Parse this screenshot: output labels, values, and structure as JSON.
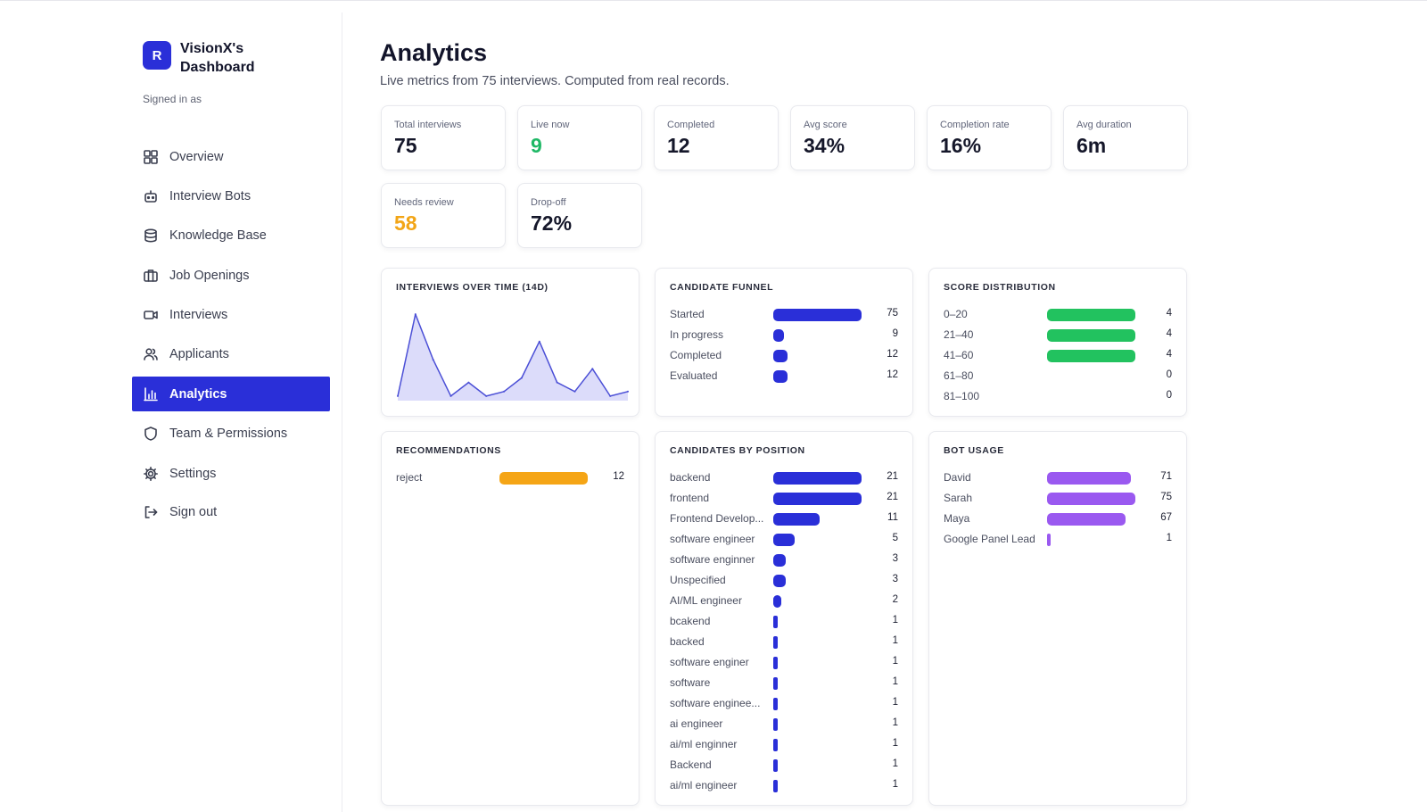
{
  "app": {
    "brand_initial": "R",
    "brand_name": "VisionX's Dashboard",
    "signed_in_label": "Signed in as"
  },
  "nav": [
    {
      "label": "Overview",
      "icon": "grid-icon"
    },
    {
      "label": "Interview Bots",
      "icon": "bot-icon"
    },
    {
      "label": "Knowledge Base",
      "icon": "database-icon"
    },
    {
      "label": "Job Openings",
      "icon": "briefcase-icon"
    },
    {
      "label": "Interviews",
      "icon": "video-icon"
    },
    {
      "label": "Applicants",
      "icon": "users-icon"
    },
    {
      "label": "Analytics",
      "icon": "chart-icon",
      "active": true
    },
    {
      "label": "Team & Permissions",
      "icon": "shield-icon"
    },
    {
      "label": "Settings",
      "icon": "gear-icon"
    },
    {
      "label": "Sign out",
      "icon": "logout-icon"
    }
  ],
  "page": {
    "title": "Analytics",
    "subtitle": "Live metrics from 75 interviews. Computed from real records."
  },
  "stats": [
    {
      "label": "Total interviews",
      "value": "75"
    },
    {
      "label": "Live now",
      "value": "9",
      "color": "#1fb866"
    },
    {
      "label": "Completed",
      "value": "12"
    },
    {
      "label": "Avg score",
      "value": "34%"
    },
    {
      "label": "Completion rate",
      "value": "16%"
    },
    {
      "label": "Avg duration",
      "value": "6m"
    },
    {
      "label": "Needs review",
      "value": "58",
      "color": "#f2a516"
    },
    {
      "label": "Drop-off",
      "value": "72%"
    }
  ],
  "cards": {
    "over_time": {
      "title": "INTERVIEWS OVER TIME (14D)"
    },
    "funnel": {
      "title": "CANDIDATE FUNNEL",
      "color": "#2a2fd8",
      "max": 75,
      "rows": [
        {
          "label": "Started",
          "value": 75
        },
        {
          "label": "In progress",
          "value": 9
        },
        {
          "label": "Completed",
          "value": 12
        },
        {
          "label": "Evaluated",
          "value": 12
        }
      ]
    },
    "score": {
      "title": "SCORE DISTRIBUTION",
      "color": "#22c25f",
      "max": 4,
      "rows": [
        {
          "label": "0–20",
          "value": 4
        },
        {
          "label": "21–40",
          "value": 4
        },
        {
          "label": "41–60",
          "value": 4
        },
        {
          "label": "61–80",
          "value": 0
        },
        {
          "label": "81–100",
          "value": 0
        }
      ]
    },
    "recommendations": {
      "title": "RECOMMENDATIONS",
      "color": "#f5a516",
      "max": 12,
      "rows": [
        {
          "label": "reject",
          "value": 12
        }
      ]
    },
    "positions": {
      "title": "CANDIDATES BY POSITION",
      "color": "#2a2fd8",
      "max": 21,
      "rows": [
        {
          "label": "backend",
          "value": 21
        },
        {
          "label": "frontend",
          "value": 21
        },
        {
          "label": "Frontend Develop...",
          "value": 11
        },
        {
          "label": "software engineer",
          "value": 5
        },
        {
          "label": "software enginner",
          "value": 3
        },
        {
          "label": "Unspecified",
          "value": 3
        },
        {
          "label": "AI/ML engineer",
          "value": 2
        },
        {
          "label": "bcakend",
          "value": 1
        },
        {
          "label": "backed",
          "value": 1
        },
        {
          "label": "software enginer",
          "value": 1
        },
        {
          "label": "software",
          "value": 1
        },
        {
          "label": "software enginee...",
          "value": 1
        },
        {
          "label": "ai engineer",
          "value": 1
        },
        {
          "label": "ai/ml enginner",
          "value": 1
        },
        {
          "label": "Backend",
          "value": 1
        },
        {
          "label": "ai/ml engineer",
          "value": 1
        }
      ]
    },
    "bot_usage": {
      "title": "BOT USAGE",
      "color": "#9a59f0",
      "max": 75,
      "rows": [
        {
          "label": "David",
          "value": 71
        },
        {
          "label": "Sarah",
          "value": 75
        },
        {
          "label": "Maya",
          "value": 67
        },
        {
          "label": "Google Panel Lead",
          "value": 1
        }
      ]
    }
  },
  "chart_data": {
    "type": "area",
    "title": "INTERVIEWS OVER TIME (14D)",
    "x": [
      1,
      2,
      3,
      4,
      5,
      6,
      7,
      8,
      9,
      10,
      11,
      12,
      13,
      14
    ],
    "values": [
      1,
      19,
      9,
      1,
      4,
      1,
      2,
      5,
      13,
      4,
      2,
      7,
      1,
      2
    ],
    "ylim": [
      0,
      20
    ],
    "color": "#4b4fd6",
    "fill": "#dcdcfa",
    "grid": false
  }
}
